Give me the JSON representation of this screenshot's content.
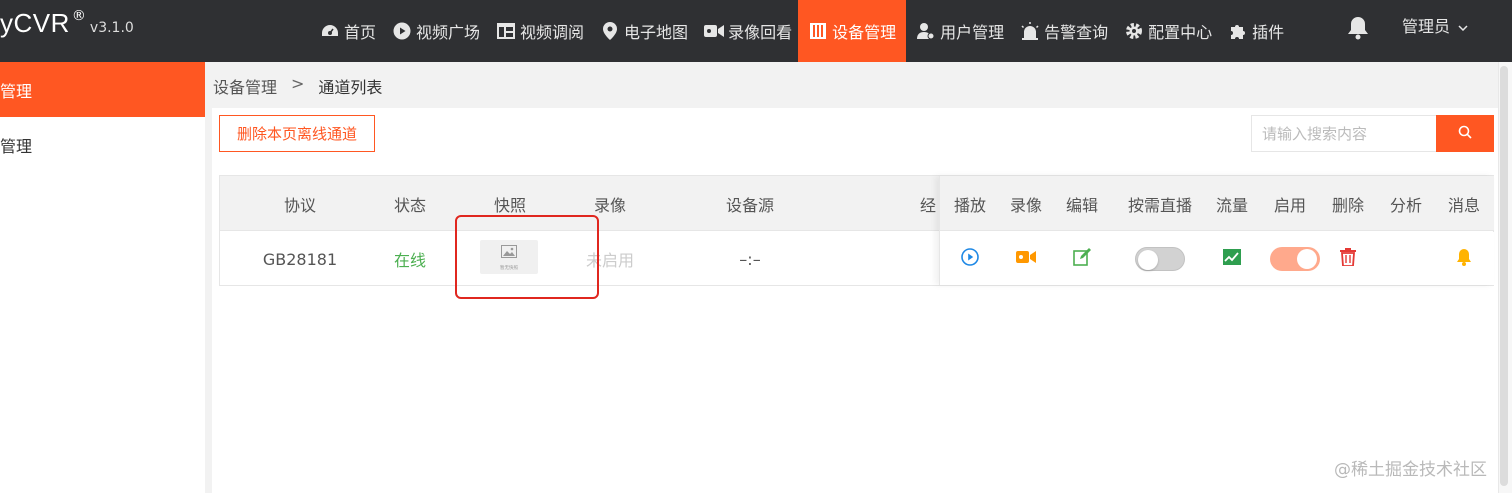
{
  "brand": {
    "name": "yCVR",
    "reg": "®",
    "version": "v3.1.0"
  },
  "nav": {
    "items": [
      {
        "label": "首页",
        "icon": "dashboard-icon"
      },
      {
        "label": "视频广场",
        "icon": "play-circle-icon"
      },
      {
        "label": "视频调阅",
        "icon": "grid-icon"
      },
      {
        "label": "电子地图",
        "icon": "map-pin-icon"
      },
      {
        "label": "录像回看",
        "icon": "video-camera-icon"
      },
      {
        "label": "设备管理",
        "icon": "columns-icon",
        "active": true
      },
      {
        "label": "用户管理",
        "icon": "user-gear-icon"
      },
      {
        "label": "告警查询",
        "icon": "alarm-light-icon"
      },
      {
        "label": "配置中心",
        "icon": "gear-icon"
      },
      {
        "label": "插件",
        "icon": "puzzle-icon"
      }
    ],
    "user": "管理员"
  },
  "side": {
    "items": [
      "管理",
      "管理"
    ]
  },
  "breadcrumb": {
    "parent": "设备管理",
    "separator": ">",
    "current": "通道列表"
  },
  "toolbar": {
    "delete_label": "删除本页离线通道",
    "search_placeholder": "请输入搜索内容"
  },
  "table": {
    "headers": {
      "protocol": "协议",
      "status": "状态",
      "snapshot": "快照",
      "record": "录像",
      "source": "设备源",
      "extra": "经",
      "play": "播放",
      "recording": "录像",
      "edit": "编辑",
      "ondemand": "按需直播",
      "flow": "流量",
      "enable": "启用",
      "delete": "删除",
      "analyze": "分析",
      "message": "消息"
    },
    "rows": [
      {
        "protocol": "GB28181",
        "status": "在线",
        "snapshot_label": "暂无快照",
        "record": "未启用",
        "source": "–:–",
        "ondemand": false,
        "enabled": true
      }
    ]
  },
  "watermark": "@稀土掘金技术社区",
  "colors": {
    "accent": "#ff5722",
    "topbar": "#2f3033",
    "online": "#4caf50",
    "play": "#1e88e5",
    "record": "#ff9800",
    "edit": "#4caf50",
    "delete": "#e53935",
    "bell": "#ffb300"
  }
}
